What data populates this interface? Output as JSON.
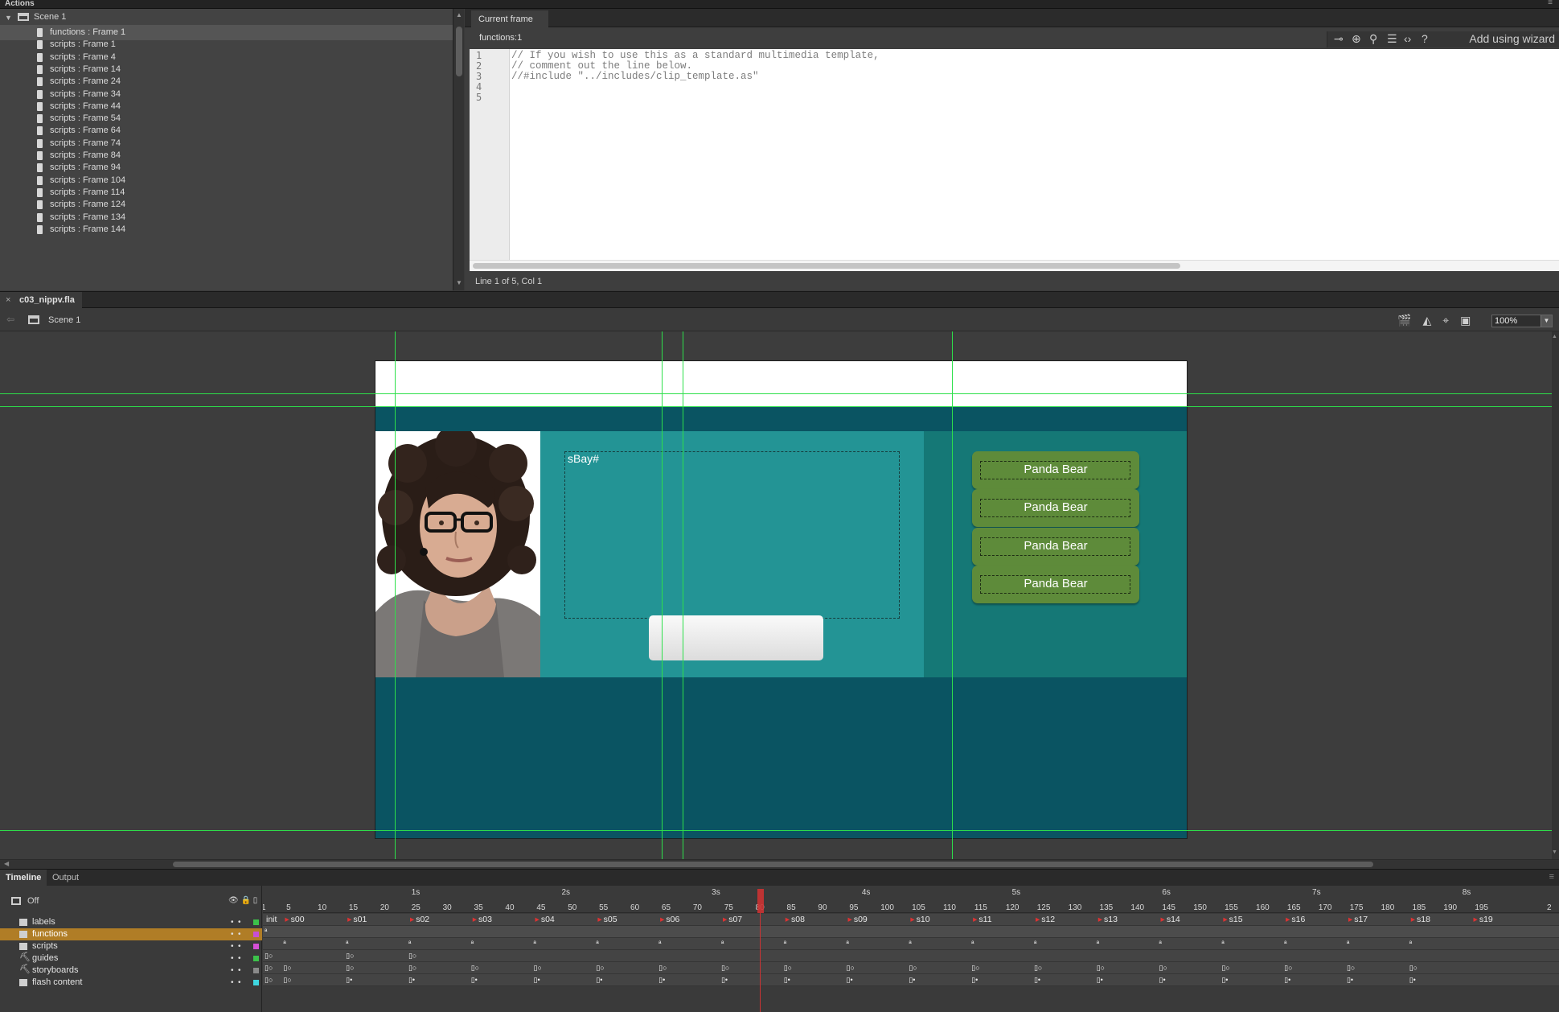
{
  "actions_panel": {
    "title": "Actions",
    "scene_label": "Scene 1",
    "scripts": [
      "functions : Frame 1",
      "scripts : Frame 1",
      "scripts : Frame 4",
      "scripts : Frame 14",
      "scripts : Frame 24",
      "scripts : Frame 34",
      "scripts : Frame 44",
      "scripts : Frame 54",
      "scripts : Frame 64",
      "scripts : Frame 74",
      "scripts : Frame 84",
      "scripts : Frame 94",
      "scripts : Frame 104",
      "scripts : Frame 114",
      "scripts : Frame 124",
      "scripts : Frame 134",
      "scripts : Frame 144"
    ],
    "editor_tab": "Current frame",
    "script_name": "functions:1",
    "wizard_label": "Add using wizard",
    "line_numbers": [
      "1",
      "2",
      "3",
      "4",
      "5"
    ],
    "code_lines": [
      "// If you wish to use this as a standard multimedia template,",
      "// comment out the line below.",
      "//#include \"../includes/clip_template.as\"",
      "",
      ""
    ],
    "status": "Line 1 of 5, Col 1"
  },
  "document": {
    "tab_name": "c03_nippv.fla",
    "close_glyph": "×",
    "scene": "Scene 1",
    "zoom": "100%"
  },
  "stage": {
    "text_field_label": "sBay#",
    "buttons": [
      "Panda Bear",
      "Panda Bear",
      "Panda Bear",
      "Panda Bear"
    ]
  },
  "timeline": {
    "tabs": [
      "Timeline",
      "Output"
    ],
    "off_label": "Off",
    "seconds": [
      "1s",
      "2s",
      "3s",
      "4s",
      "5s",
      "6s",
      "7s",
      "8s"
    ],
    "ticks": [
      "1",
      "5",
      "10",
      "15",
      "20",
      "25",
      "30",
      "35",
      "40",
      "45",
      "50",
      "55",
      "60",
      "65",
      "70",
      "75",
      "80",
      "85",
      "90",
      "95",
      "100",
      "105",
      "110",
      "115",
      "120",
      "125",
      "130",
      "135",
      "140",
      "145",
      "150",
      "155",
      "160",
      "165",
      "170",
      "175",
      "180",
      "185",
      "190",
      "195",
      "2"
    ],
    "frame_labels": [
      "init",
      "s00",
      "s01",
      "s02",
      "s03",
      "s04",
      "s05",
      "s06",
      "s07",
      "s08",
      "s09",
      "s10",
      "s11",
      "s12",
      "s13",
      "s14",
      "s15",
      "s16",
      "s17",
      "s18",
      "s19"
    ],
    "layers": [
      {
        "name": "labels",
        "color": "#3cc24a"
      },
      {
        "name": "functions",
        "color": "#c74fd6"
      },
      {
        "name": "scripts",
        "color": "#d64fd6"
      },
      {
        "name": "guides",
        "color": "#3cc24a"
      },
      {
        "name": "storyboards",
        "color": "#8a8a8a"
      },
      {
        "name": "flash content",
        "color": "#3fd6e0"
      }
    ],
    "selected_layer": "functions"
  },
  "colors": {
    "guide": "#2de04a",
    "stage_teal": "#239495",
    "stage_dark": "#0a5462",
    "button_green": "#5e8b3a",
    "selected_layer": "#b07d26"
  }
}
